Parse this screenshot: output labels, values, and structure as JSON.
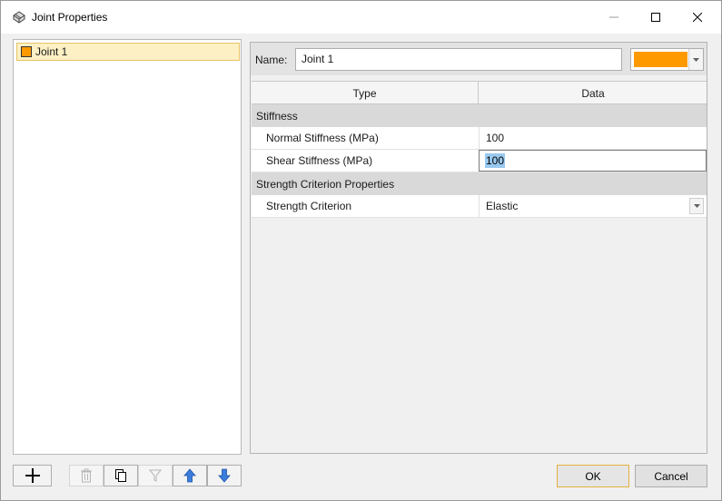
{
  "window": {
    "title": "Joint Properties"
  },
  "tree": {
    "items": [
      {
        "label": "Joint 1",
        "color": "#ff9900",
        "selected": true
      }
    ]
  },
  "properties": {
    "name_label": "Name:",
    "name_value": "Joint 1",
    "color": "#ff9900",
    "grid": {
      "col_type": "Type",
      "col_data": "Data",
      "groups": [
        {
          "title": "Stiffness",
          "rows": [
            {
              "name": "Normal Stiffness (MPa)",
              "value": "100"
            },
            {
              "name": "Shear Stiffness (MPa)",
              "value": "100"
            }
          ]
        },
        {
          "title": "Strength Criterion Properties",
          "rows": [
            {
              "name": "Strength Criterion",
              "value": "Elastic"
            }
          ]
        }
      ]
    }
  },
  "buttons": {
    "ok": "OK",
    "cancel": "Cancel"
  }
}
